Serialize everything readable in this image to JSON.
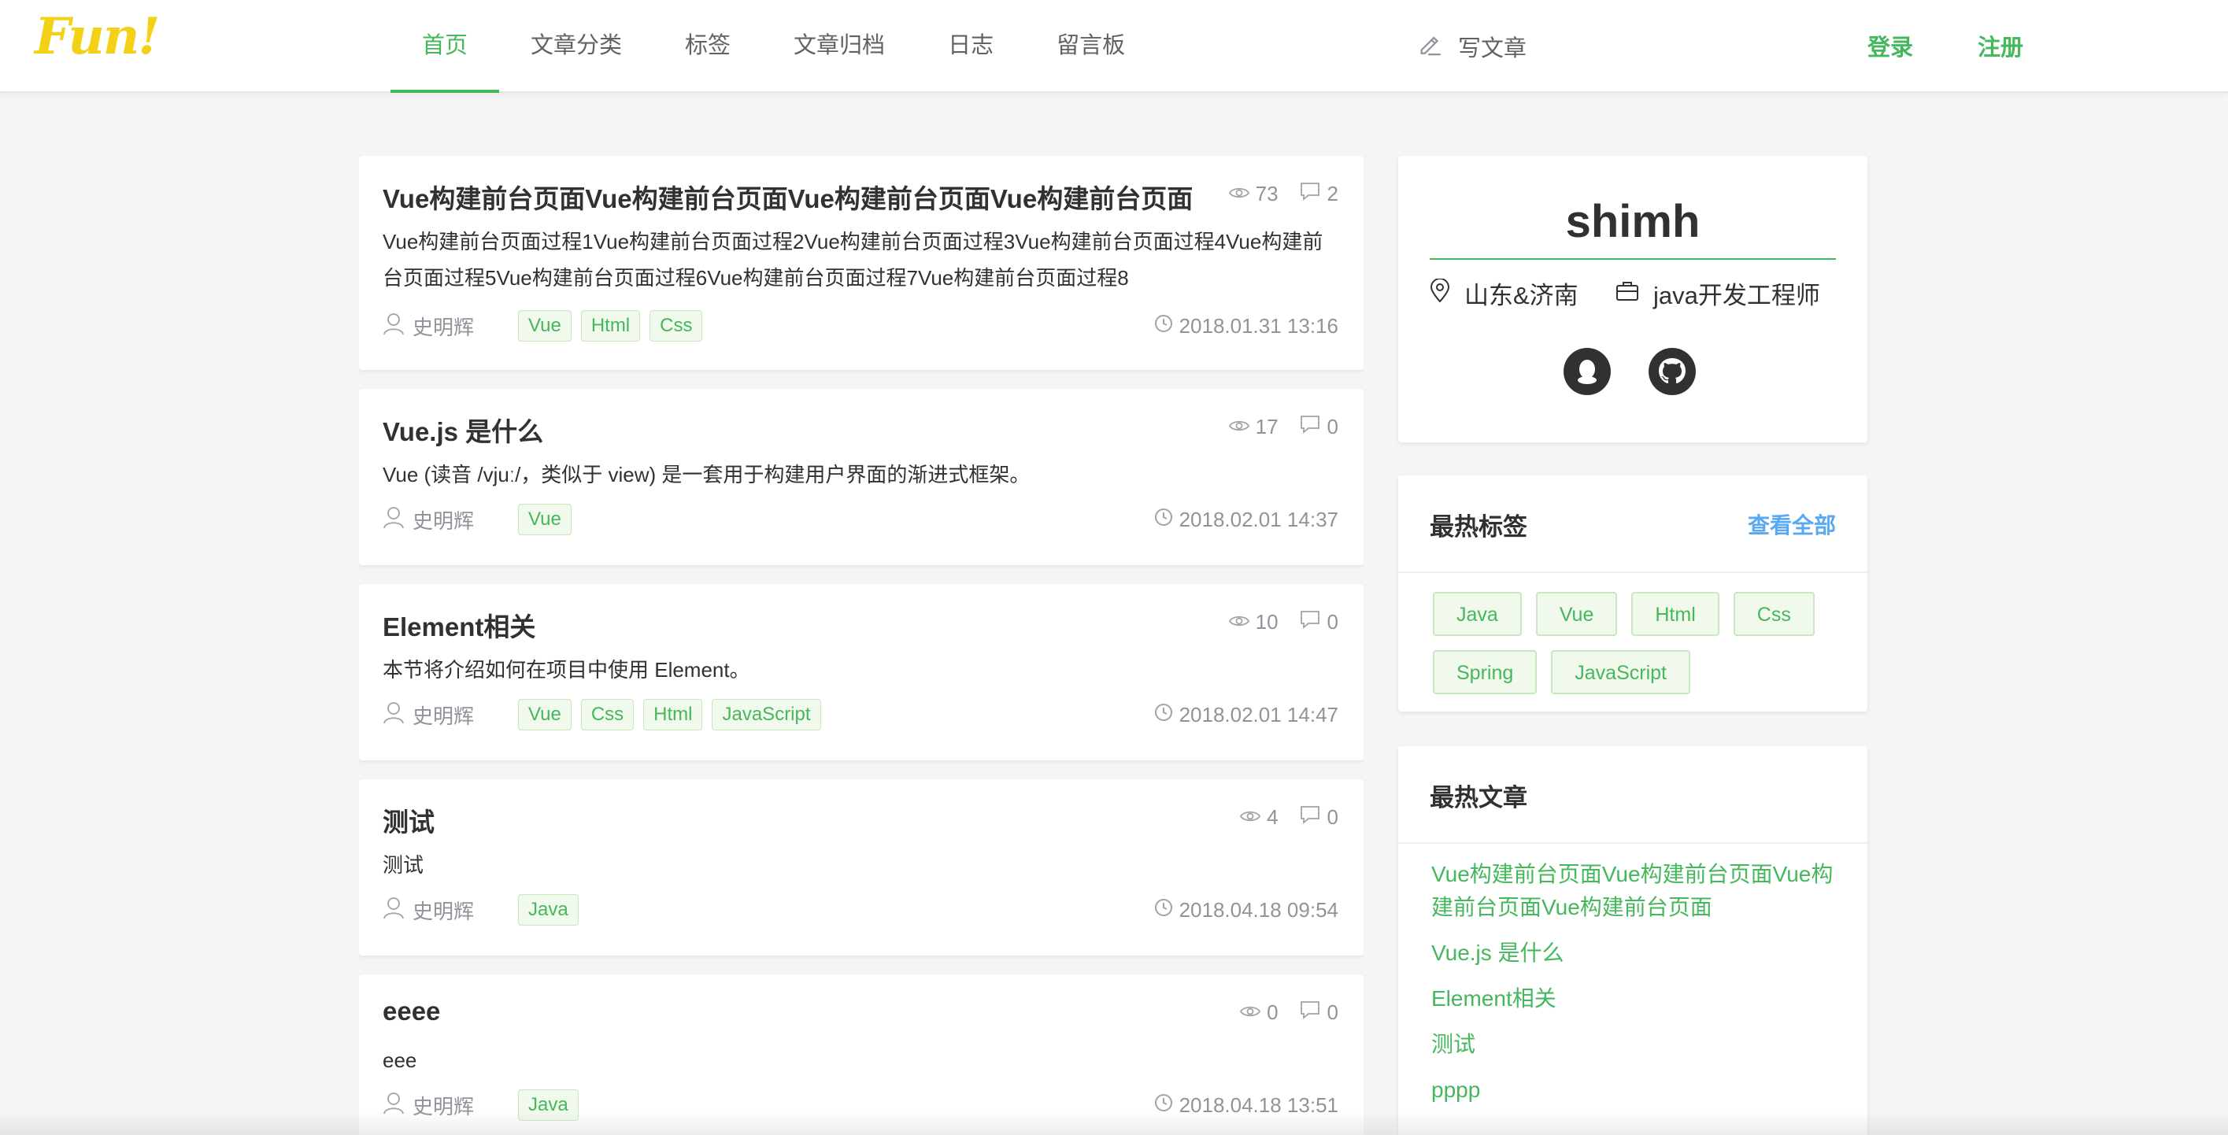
{
  "header": {
    "logo_text": "Fun!",
    "nav": [
      {
        "label": "首页",
        "active": true
      },
      {
        "label": "文章分类",
        "active": false
      },
      {
        "label": "标签",
        "active": false
      },
      {
        "label": "文章归档",
        "active": false
      },
      {
        "label": "日志",
        "active": false
      },
      {
        "label": "留言板",
        "active": false
      }
    ],
    "write_label": "写文章",
    "login_label": "登录",
    "register_label": "注册"
  },
  "articles": [
    {
      "title": "Vue构建前台页面Vue构建前台页面Vue构建前台页面Vue构建前台页面",
      "views": "73",
      "comments": "2",
      "summary": "Vue构建前台页面过程1Vue构建前台页面过程2Vue构建前台页面过程3Vue构建前台页面过程4Vue构建前台页面过程5Vue构建前台页面过程6Vue构建前台页面过程7Vue构建前台页面过程8",
      "author": "史明辉",
      "tags": [
        "Vue",
        "Html",
        "Css"
      ],
      "time": "2018.01.31 13:16"
    },
    {
      "title": "Vue.js 是什么",
      "views": "17",
      "comments": "0",
      "summary": "Vue (读音 /vjuː/，类似于 view) 是一套用于构建用户界面的渐进式框架。",
      "author": "史明辉",
      "tags": [
        "Vue"
      ],
      "time": "2018.02.01 14:37"
    },
    {
      "title": "Element相关",
      "views": "10",
      "comments": "0",
      "summary": "本节将介绍如何在项目中使用 Element。",
      "author": "史明辉",
      "tags": [
        "Vue",
        "Css",
        "Html",
        "JavaScript"
      ],
      "time": "2018.02.01 14:47"
    },
    {
      "title": "测试",
      "views": "4",
      "comments": "0",
      "summary": "测试",
      "author": "史明辉",
      "tags": [
        "Java"
      ],
      "time": "2018.04.18 09:54"
    },
    {
      "title": "eeee",
      "views": "0",
      "comments": "0",
      "summary": "eee",
      "author": "史明辉",
      "tags": [
        "Java"
      ],
      "time": "2018.04.18 13:51"
    }
  ],
  "profile": {
    "name": "shimh",
    "location": "山东&济南",
    "job": "java开发工程师",
    "social": [
      "qq-icon",
      "github-icon"
    ]
  },
  "hot_tags": {
    "title": "最热标签",
    "view_all": "查看全部",
    "tags": [
      "Java",
      "Vue",
      "Html",
      "Css",
      "Spring",
      "JavaScript"
    ]
  },
  "hot_articles": {
    "title": "最热文章",
    "items": [
      "Vue构建前台页面Vue构建前台页面Vue构建前台页面Vue构建前台页面",
      "Vue.js 是什么",
      "Element相关",
      "测试",
      "pppp"
    ]
  },
  "colors": {
    "accent": "#45b75c",
    "link_blue": "#5aa9f0",
    "tag_bg": "#f0f9eb"
  }
}
